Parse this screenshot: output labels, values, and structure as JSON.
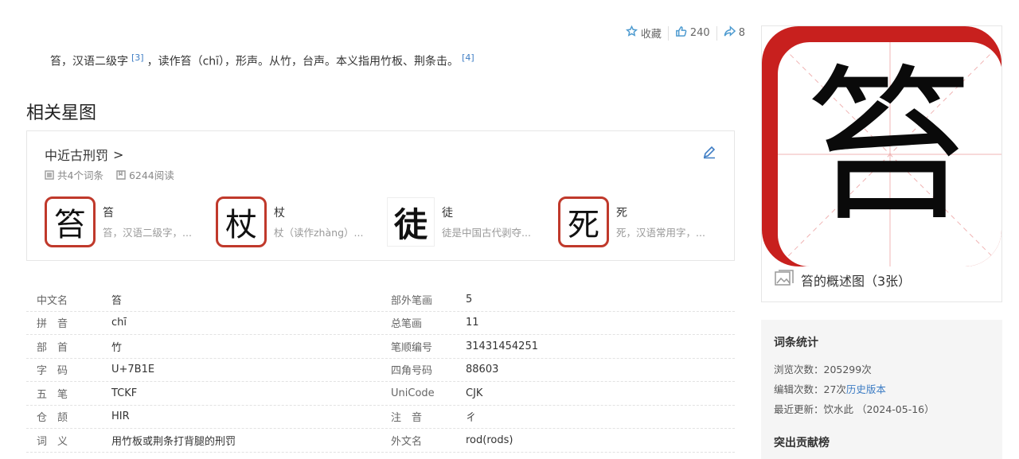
{
  "actions": {
    "favorite_label": "收藏",
    "like_count": "240",
    "share_count": "8"
  },
  "intro": {
    "part1": "笞，汉语二级字",
    "ref1": "[3]",
    "part2": "，读作笞（chī），形声。从竹，台声。本义指用竹板、荆条击。",
    "ref2": "[4]"
  },
  "section_title": "相关星图",
  "star_map": {
    "title": "中近古刑罚",
    "chevron": ">",
    "entries_count": "共4个词条",
    "reads": "6244阅读",
    "items": [
      {
        "char": "笞",
        "title": "笞",
        "desc": "笞，汉语二级字，..."
      },
      {
        "char": "杖",
        "title": "杖",
        "desc": "杖（读作zhàng）..."
      },
      {
        "char": "徒",
        "title": "徒",
        "desc": "徒是中国古代剥夺..."
      },
      {
        "char": "死",
        "title": "死",
        "desc": "死，汉语常用字，..."
      }
    ]
  },
  "info_rows": [
    {
      "k": "中文名",
      "v": "笞",
      "k2": "部外笔画",
      "v2": "5"
    },
    {
      "k": "拼　音",
      "v": "chī",
      "k2": "总笔画",
      "v2": "11"
    },
    {
      "k": "部　首",
      "v": "竹",
      "k2": "笔顺编号",
      "v2": "31431454251"
    },
    {
      "k": "字　码",
      "v": "U+7B1E",
      "k2": "四角号码",
      "v2": "88603"
    },
    {
      "k": "五　笔",
      "v": "TCKF",
      "k2": "UniCode",
      "v2": "CJK"
    },
    {
      "k": "仓　颉",
      "v": "HIR",
      "k2": "注　音",
      "v2": "ㄔ"
    },
    {
      "k": "词　义",
      "v": "用竹板或荆条打背腿的刑罚",
      "k2": "外文名",
      "v2": "rod(rods)"
    }
  ],
  "side_image": {
    "char": "笞",
    "caption": "笞的概述图（3张）"
  },
  "stats": {
    "title": "词条统计",
    "views_label": "浏览次数：205299次",
    "edits_label": "编辑次数：27次",
    "history_link": "历史版本",
    "updated_label": "最近更新：饮水此 （2024-05-16）",
    "contrib_title": "突出贡献榜"
  },
  "colors": {
    "accent": "#3e7dc4",
    "tile_red": "#c8201e"
  }
}
